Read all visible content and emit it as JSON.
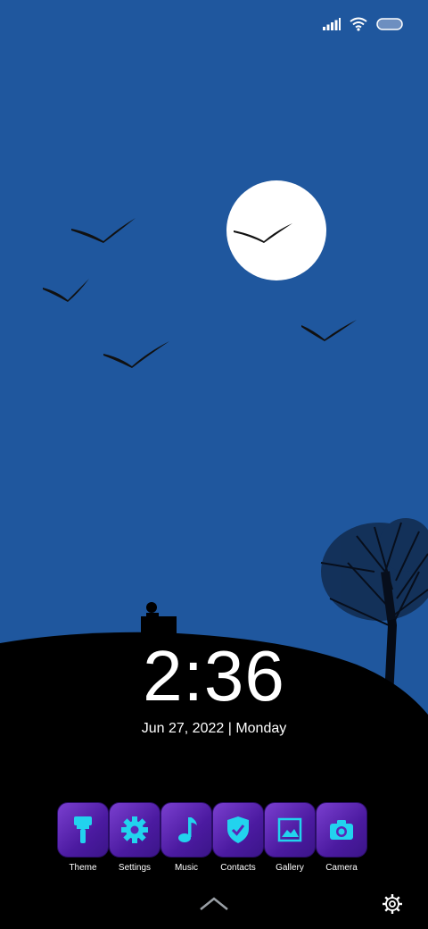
{
  "status_bar": {
    "icons": [
      "signal-icon",
      "wifi-icon",
      "battery-icon"
    ],
    "colors": {
      "icon": "#ffffff"
    }
  },
  "lock_screen": {
    "time": "2:36",
    "date": "Jun 27, 2022 | Monday"
  },
  "dock": {
    "apps": [
      {
        "label": "Theme",
        "icon": "paint-brush-icon"
      },
      {
        "label": "Settings",
        "icon": "gear-icon"
      },
      {
        "label": "Music",
        "icon": "music-note-icon"
      },
      {
        "label": "Contacts",
        "icon": "shield-check-icon"
      },
      {
        "label": "Gallery",
        "icon": "image-icon"
      },
      {
        "label": "Camera",
        "icon": "camera-icon"
      }
    ],
    "colors": {
      "tile": "#5a26b8",
      "glyph": "#22d3ee"
    }
  },
  "bottom": {
    "icons": [
      "swipe-up-chevron-icon",
      "lock-settings-gear-icon"
    ]
  },
  "wallpaper": {
    "colors": {
      "sky": "#1f579e",
      "moon": "#ffffff",
      "ground": "#000000"
    }
  }
}
